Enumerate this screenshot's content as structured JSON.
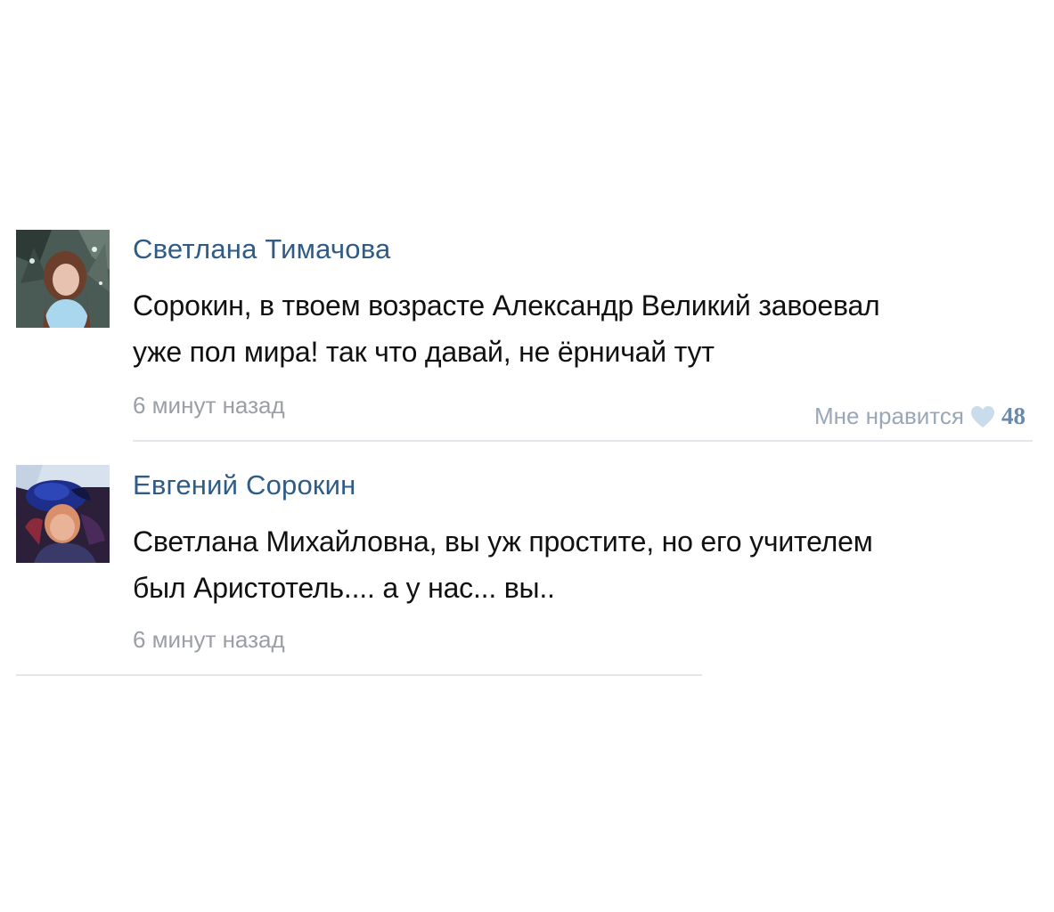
{
  "comments": [
    {
      "author": "Светлана Тимачова",
      "text_line1": "Сорокин, в твоем возрасте Александр Великий завоевал",
      "text_line2": "уже пол мира! так что давай, не ёрничай тут",
      "time": "6 минут назад",
      "like_label": "Мне нравится",
      "like_count": "48",
      "avatar_icon": "user-photo-icon"
    },
    {
      "author": "Евгений Сорокин",
      "text_line1": "Светлана Михайловна, вы уж простите, но его учителем",
      "text_line2": "был Аристотель.... а у нас... вы..",
      "time": "6 минут назад",
      "avatar_icon": "user-photo-icon"
    }
  ],
  "colors": {
    "author": "#2f5b87",
    "text": "#111111",
    "meta": "#9a9fa6",
    "heart": "#c9dcec",
    "divider": "#e3e6ea"
  }
}
